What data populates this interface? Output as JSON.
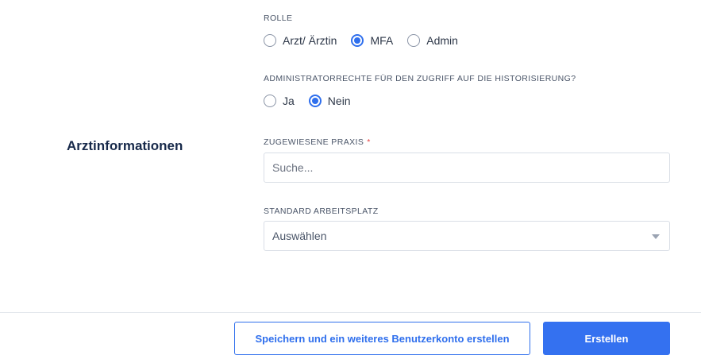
{
  "section": {
    "title": "Arztinformationen"
  },
  "role": {
    "label": "ROLLE",
    "options": [
      {
        "label": "Arzt/ Ärztin",
        "checked": false
      },
      {
        "label": "MFA",
        "checked": true
      },
      {
        "label": "Admin",
        "checked": false
      }
    ]
  },
  "admin_rights": {
    "label": "ADMINISTRATORRECHTE FÜR DEN ZUGRIFF AUF DIE HISTORISIERUNG?",
    "options": [
      {
        "label": "Ja",
        "checked": false
      },
      {
        "label": "Nein",
        "checked": true
      }
    ]
  },
  "practice": {
    "label": "ZUGEWIESENE PRAXIS",
    "required_marker": "*",
    "placeholder": "Suche...",
    "value": ""
  },
  "workplace": {
    "label": "STANDARD ARBEITSPLATZ",
    "selected": "Auswählen"
  },
  "footer": {
    "save_and_new_label": "Speichern und ein weiteres Benutzerkonto erstellen",
    "create_label": "Erstellen"
  },
  "colors": {
    "accent": "#2f6fed",
    "primary_button": "#3471f0",
    "required": "#e53e3e",
    "heading": "#17294a"
  }
}
